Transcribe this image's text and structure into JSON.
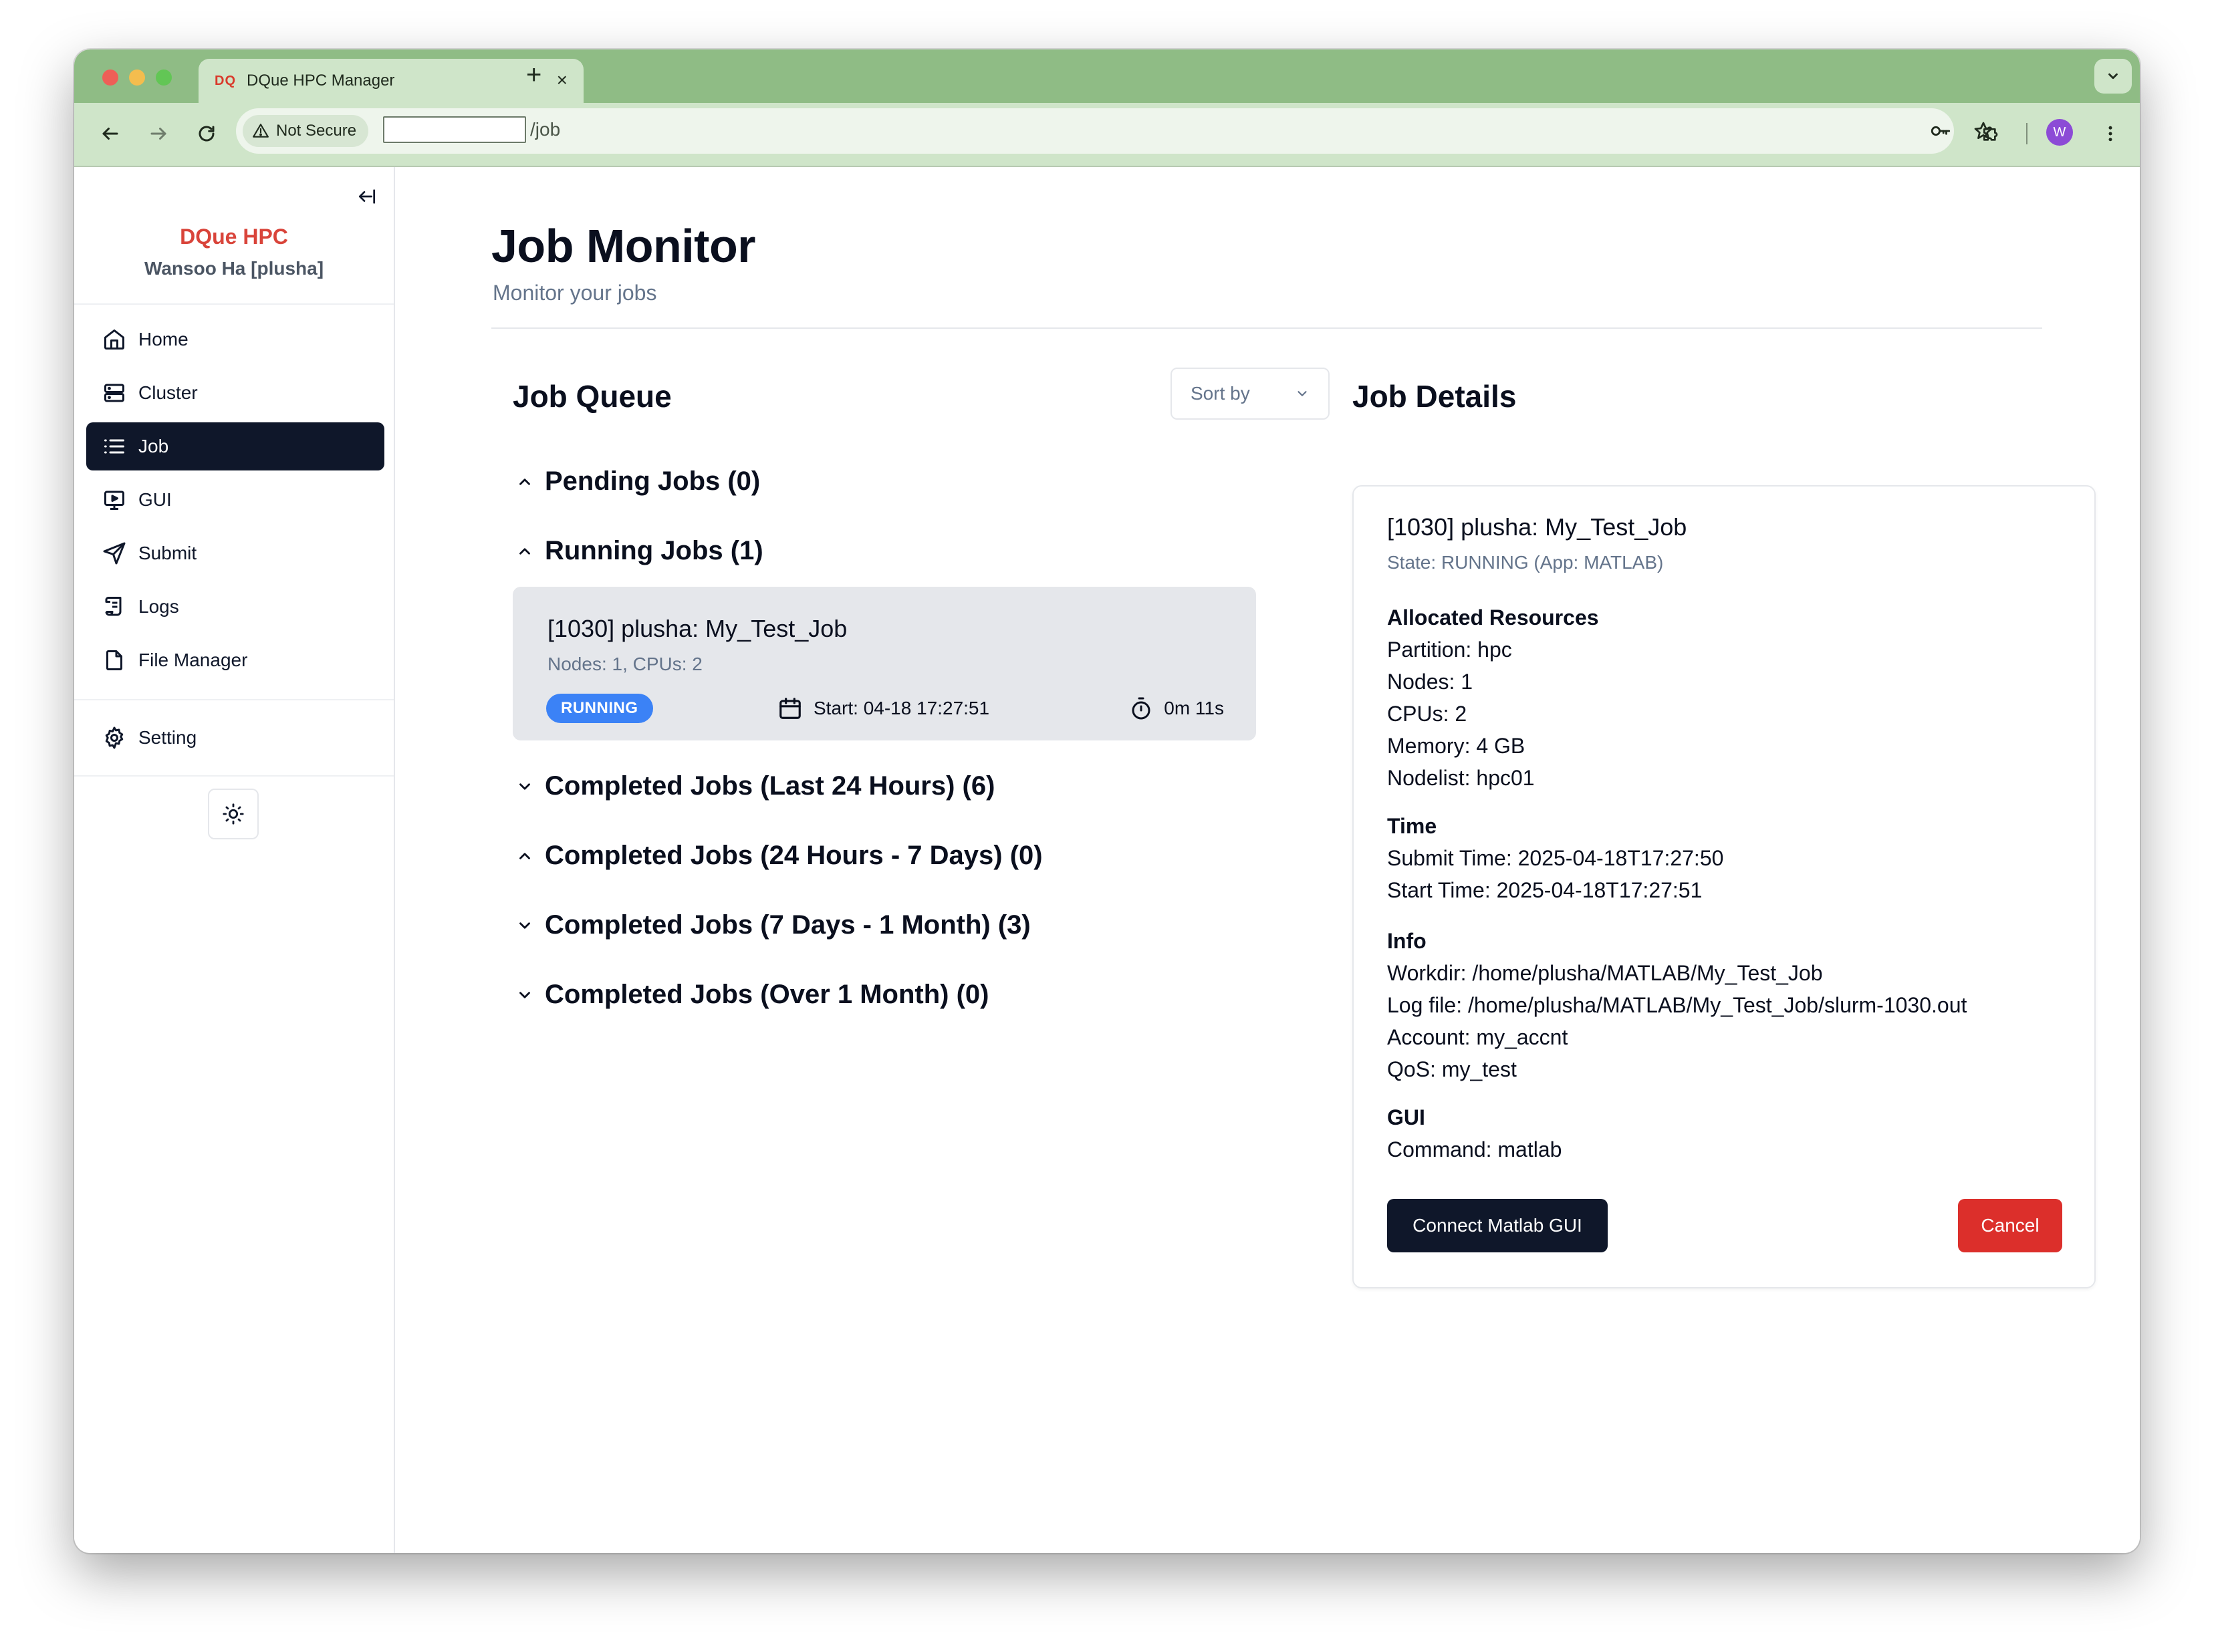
{
  "browser": {
    "tab": {
      "favicon_text": "DQ",
      "title": "DQue HPC Manager",
      "close_glyph": "×"
    },
    "new_tab_glyph": "+",
    "omnibox": {
      "security_label": "Not Secure",
      "url_input_value": "",
      "url_path": "/job"
    },
    "profile_initial": "W"
  },
  "sidebar": {
    "brand": "DQue HPC",
    "user": "Wansoo Ha [plusha]",
    "brand_color": "#d9443a",
    "items": [
      {
        "label": "Home",
        "icon": "home-icon"
      },
      {
        "label": "Cluster",
        "icon": "server-icon"
      },
      {
        "label": "Job",
        "icon": "list-icon",
        "active": true
      },
      {
        "label": "GUI",
        "icon": "monitor-icon"
      },
      {
        "label": "Submit",
        "icon": "send-icon"
      },
      {
        "label": "Logs",
        "icon": "scroll-icon"
      },
      {
        "label": "File Manager",
        "icon": "file-icon"
      }
    ],
    "setting": {
      "label": "Setting",
      "icon": "gear-icon"
    },
    "theme_icon": "sun-icon"
  },
  "page": {
    "title": "Job Monitor",
    "subtitle": "Monitor your jobs"
  },
  "queue": {
    "title": "Job Queue",
    "sort_placeholder": "Sort by",
    "groups": [
      {
        "label": "Pending Jobs (0)",
        "expanded": true
      },
      {
        "label": "Running Jobs (1)",
        "expanded": true
      },
      {
        "label": "Completed Jobs (Last 24 Hours) (6)",
        "expanded": false
      },
      {
        "label": "Completed Jobs (24 Hours - 7 Days) (0)",
        "expanded": true
      },
      {
        "label": "Completed Jobs (7 Days - 1 Month) (3)",
        "expanded": false
      },
      {
        "label": "Completed Jobs (Over 1 Month) (0)",
        "expanded": false
      }
    ],
    "running_job": {
      "title": "[1030] plusha: My_Test_Job",
      "meta": "Nodes: 1, CPUs: 2",
      "state": "RUNNING",
      "state_color": "#3b82f6",
      "start": "Start: 04-18 17:27:51",
      "elapsed": "0m 11s"
    }
  },
  "details": {
    "section_title": "Job Details",
    "title": "[1030] plusha: My_Test_Job",
    "state": "State: RUNNING (App: MATLAB)",
    "resources": {
      "heading": "Allocated Resources",
      "lines": [
        "Partition: hpc",
        "Nodes: 1",
        "CPUs: 2",
        "Memory: 4 GB",
        "Nodelist: hpc01"
      ]
    },
    "time": {
      "heading": "Time",
      "lines": [
        "Submit Time: 2025-04-18T17:27:50",
        "Start Time: 2025-04-18T17:27:51"
      ]
    },
    "info": {
      "heading": "Info",
      "lines": [
        "Workdir: /home/plusha/MATLAB/My_Test_Job",
        "Log file: /home/plusha/MATLAB/My_Test_Job/slurm-1030.out",
        "Account: my_accnt",
        "QoS: my_test"
      ]
    },
    "gui": {
      "heading": "GUI",
      "lines": [
        "Command: matlab"
      ]
    },
    "connect_button": "Connect Matlab GUI",
    "cancel_button": "Cancel",
    "cancel_color": "#dc2f2b"
  }
}
